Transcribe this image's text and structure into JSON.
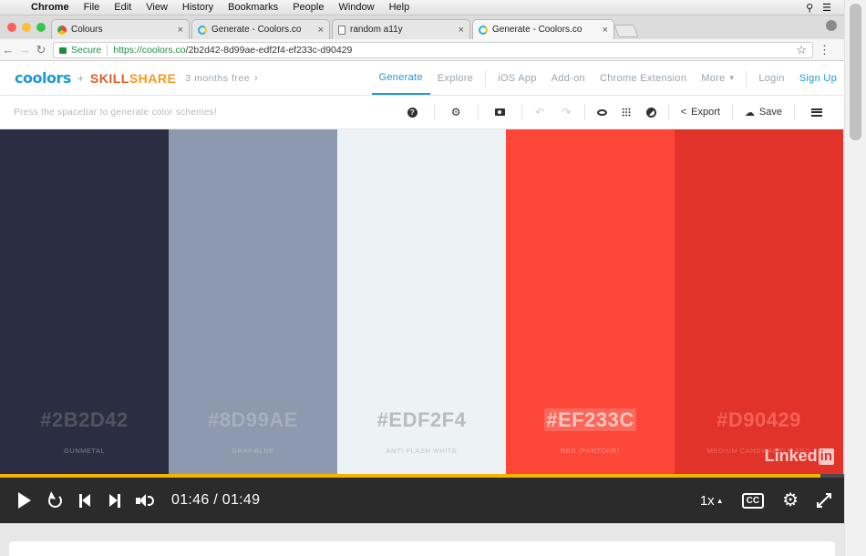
{
  "menubar": {
    "app": "Chrome",
    "items": [
      "File",
      "Edit",
      "View",
      "History",
      "Bookmarks",
      "People",
      "Window",
      "Help"
    ]
  },
  "tabs": [
    {
      "title": "Colours",
      "icon": "google-icon",
      "active": false
    },
    {
      "title": "Generate - Coolors.co",
      "icon": "coolors-icon",
      "active": false
    },
    {
      "title": "random a11y",
      "icon": "document-icon",
      "active": false
    },
    {
      "title": "Generate - Coolors.co",
      "icon": "coolors-icon",
      "active": true
    }
  ],
  "address": {
    "secure_label": "Secure",
    "url_host": "https://coolors.co",
    "url_path": "/2b2d42-8d99ae-edf2f4-ef233c-d90429"
  },
  "coolors_nav": {
    "logo": "coolors",
    "plus": "+",
    "skill_part1": "SKILL",
    "skill_part2": "SHARE",
    "promo": "3 months free",
    "links": [
      "Generate",
      "Explore",
      "iOS App",
      "Add-on",
      "Chrome Extension",
      "More"
    ],
    "active_link": "Generate",
    "login": "Login",
    "signup": "Sign Up"
  },
  "toolbar": {
    "hint": "Press the spacebar to generate color schemes!",
    "export_label": "Export",
    "save_label": "Save"
  },
  "palette": [
    {
      "hex": "#2B2D42",
      "name": "GUNMETAL",
      "bg": "#2b2d42",
      "hex_color": "#51545f",
      "name_color": "#7a7d8a"
    },
    {
      "hex": "#8D99AE",
      "name": "GRAY-BLUE",
      "bg": "#8d99ae",
      "hex_color": "#a5afbf",
      "name_color": "#b0b9c7"
    },
    {
      "hex": "#EDF2F4",
      "name": "ANTI-FLASH WHITE",
      "bg": "#edf2f4",
      "hex_color": "#b8bcbf",
      "name_color": "#c3c7ca"
    },
    {
      "hex": "#EF233C",
      "name": "RED (PANTONE)",
      "bg": "#fb4638",
      "hex_color": "#ffc7bd",
      "name_color": "#ff8f86"
    },
    {
      "hex": "#D90429",
      "name": "MEDIUM CANDY APPLE RED",
      "bg": "#e2332a",
      "hex_color": "#f26158",
      "name_color": "#ee6a60"
    }
  ],
  "watermark": {
    "text": "Linked",
    "badge": "in"
  },
  "player": {
    "time": "01:46 / 01:49",
    "speed": "1x",
    "cc": "CC",
    "progress_fraction": 0.972
  }
}
